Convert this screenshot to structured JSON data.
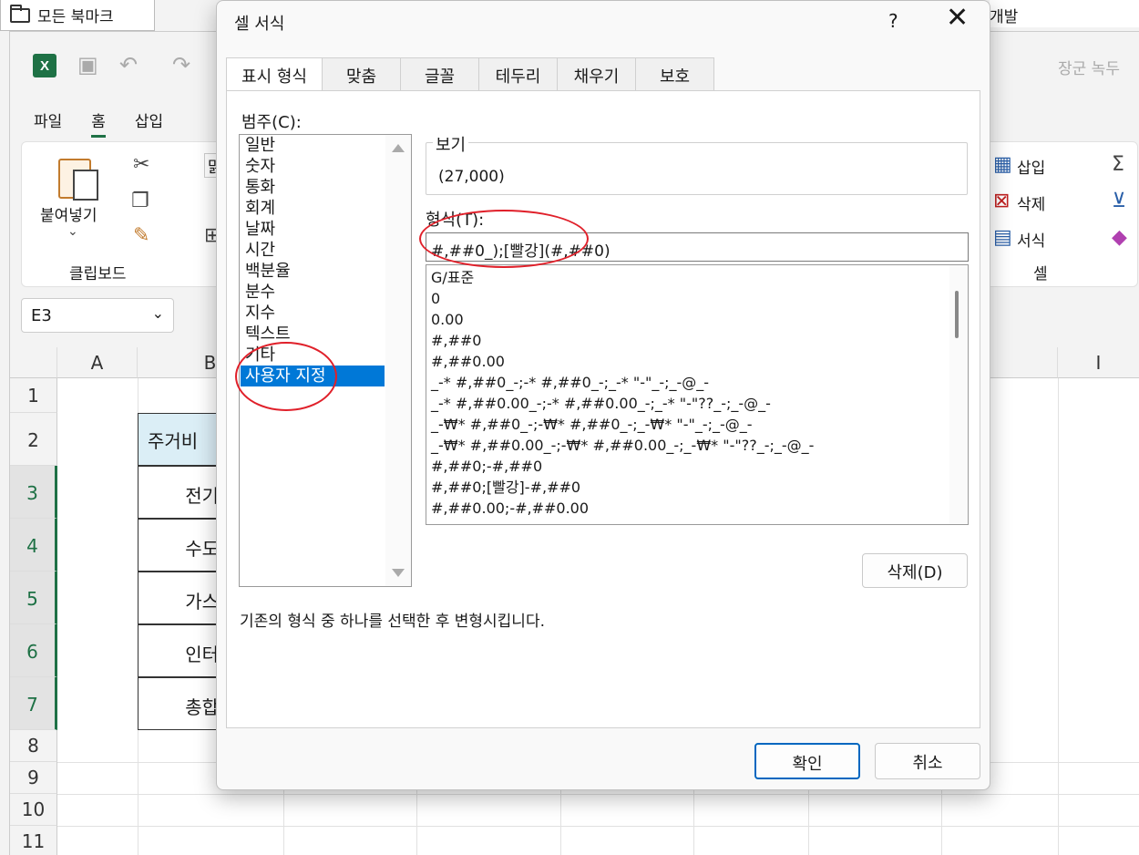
{
  "browser": {
    "bookmarks_tab": "모든 북마크",
    "right_tab": "개발"
  },
  "excel": {
    "right_title": "장군 녹두",
    "menu": [
      "파일",
      "홈",
      "삽입"
    ],
    "ribbon": {
      "paste_label": "붙여넣기",
      "clipboard_group": "클립보드",
      "font_box": "맑",
      "cells_insert": "삽입",
      "cells_delete": "삭제",
      "cells_format": "서식",
      "cells_group": "셀"
    },
    "name_box": "E3",
    "columns": [
      "A",
      "B",
      "I"
    ],
    "rows": [
      "1",
      "2",
      "3",
      "4",
      "5",
      "6",
      "7",
      "8",
      "9",
      "10",
      "11"
    ],
    "cells": [
      "주거비",
      "전기",
      "수도",
      "가스",
      "인터",
      "총합"
    ]
  },
  "dialog": {
    "title": "셀 서식",
    "help": "?",
    "close": "✕",
    "tabs": [
      "표시 형식",
      "맞춤",
      "글꼴",
      "테두리",
      "채우기",
      "보호"
    ],
    "category_label": "범주(C):",
    "categories": [
      "일반",
      "숫자",
      "통화",
      "회계",
      "날짜",
      "시간",
      "백분율",
      "분수",
      "지수",
      "텍스트",
      "기타",
      "사용자 지정"
    ],
    "selected_category": "사용자 지정",
    "sample_title": "보기",
    "sample_value": "(27,000)",
    "format_label": "형식(T):",
    "format_value": "#,##0_);[빨강](#,##0)",
    "format_list": [
      "G/표준",
      "0",
      "0.00",
      "#,##0",
      "#,##0.00",
      "_-* #,##0_-;-* #,##0_-;_-* \"-\"_-;_-@_-",
      "_-* #,##0.00_-;-* #,##0.00_-;_-* \"-\"??_-;_-@_-",
      "_-₩* #,##0_-;-₩* #,##0_-;_-₩* \"-\"_-;_-@_-",
      "_-₩* #,##0.00_-;-₩* #,##0.00_-;_-₩* \"-\"??_-;_-@_-",
      "#,##0;-#,##0",
      "#,##0;[빨강]-#,##0",
      "#,##0.00;-#,##0.00"
    ],
    "delete_button": "삭제(D)",
    "description": "기존의 형식 중 하나를 선택한 후 변형시킵니다.",
    "ok_button": "확인",
    "cancel_button": "취소"
  }
}
